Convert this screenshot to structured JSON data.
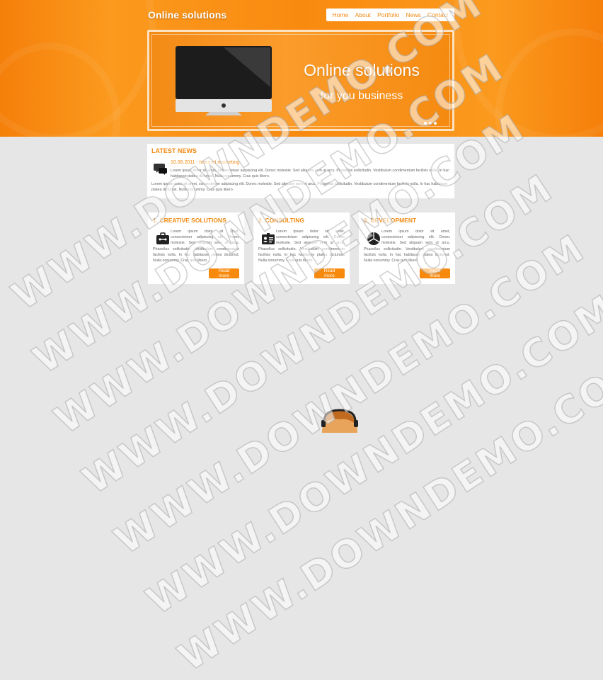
{
  "site": {
    "logo": "Online solutions"
  },
  "nav": {
    "items": [
      "Home",
      "About",
      "Portfolio",
      "News",
      "Contact"
    ]
  },
  "slider": {
    "title": "Online solutions",
    "subtitle": "for you business"
  },
  "news": {
    "heading": "LATEST NEWS",
    "meta": "10.08.2011 - Internet marketing",
    "paragraph1": "Lorem ipsum dolor sit amet, consectetuer adipiscing elit. Donec molestie. Sed aliquam sem ut arcu. Phasellus sollicitudin. Vestibulum condimentum facilisis nulla. In hac habitasse platea dictumst. Nulla nonummy. Cras quis libero.",
    "paragraph2": "Lorem ipsum dolor sit amet, consectetuer adipiscing elit. Donec molestie. Sed aliquam sem ut arcu. Phasellus sollicitudin. Vestibulum condimentum facilisis nulla. In hac habitasse platea dictumst. Nulla nonummy. Cras quis libero."
  },
  "cards": [
    {
      "title": "1. CREATIVE SOLUTIONS",
      "icon": "briefcase-icon",
      "text": "Lorem ipsum dolor sit amet, consectetuer adipiscing elit. Donec molestie. Sed aliquam sem ut arcu. Phasellus sollicitudin. Vestibulum condimentum facilisis nulla. In hac habitasse platea dictumst. Nulla nonummy. Cras quis libero.",
      "button": "Read more"
    },
    {
      "title": "2. CONSULTING",
      "icon": "id-card-icon",
      "text": "Lorem ipsum dolor sit amet, consectetuer adipiscing elit. Donec molestie. Sed aliquam sem ut arcu. Phasellus sollicitudin. Vestibulum condimentum facilisis nulla. In hac habitasse platea dictumst. Nulla nonummy. Cras quis libero.",
      "button": "Read more"
    },
    {
      "title": "3. DEVELOPMENT",
      "icon": "pie-chart-icon",
      "text": "Lorem ipsum dolor sit amet, consectetuer adipiscing elit. Donec molestie. Sed aliquam sem ut arcu. Phasellus sollicitudin. Vestibulum condimentum facilisis nulla. In hac habitasse platea dictumst. Nulla nonummy. Cras quis libero.",
      "button": "Read more"
    }
  ],
  "watermark": {
    "text": "WWW.DOWNDEMO.COM"
  },
  "colors": {
    "accent": "#f08a12",
    "header": "#fb9a1e",
    "background": "#e6e6e6"
  }
}
